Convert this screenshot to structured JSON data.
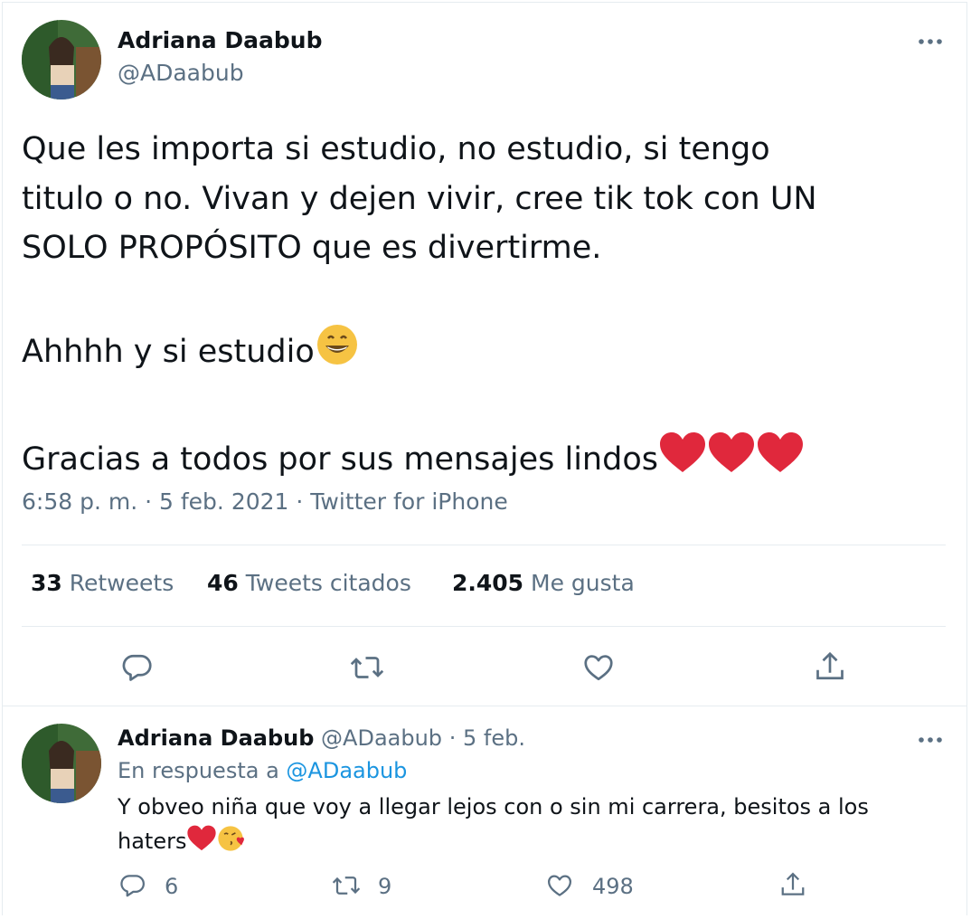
{
  "main_tweet": {
    "author_name": "Adriana Daabub",
    "author_handle": "@ADaabub",
    "text_line1": "Que les importa si estudio, no estudio, si tengo",
    "text_line2": "titulo o no. Vivan y dejen vivir, cree tik tok con UN",
    "text_line3": "SOLO PROPÓSITO que es divertirme.",
    "text_line4": "Ahhhh y si estudio",
    "text_line5": "Gracias a todos por sus mensajes lindos",
    "emoji_after_line4": "grinning-face-with-smiling-eyes",
    "emojis_after_line5": [
      "red-heart",
      "red-heart",
      "red-heart"
    ],
    "time": "6:58 p. m.",
    "date": "5 feb. 2021",
    "source": "Twitter for iPhone",
    "separator": "·",
    "stats": {
      "retweets_count": "33",
      "retweets_label": "Retweets",
      "quotes_count": "46",
      "quotes_label": "Tweets citados",
      "likes_count": "2.405",
      "likes_label": "Me gusta"
    }
  },
  "reply_tweet": {
    "author_name": "Adriana Daabub",
    "author_handle": "@ADaabub",
    "separator": "·",
    "date": "5 feb.",
    "in_reply_prefix": "En respuesta a",
    "in_reply_handle": "@ADaabub",
    "text_line1": "Y obveo niña que voy a llegar lejos con o sin mi carrera, besitos a los",
    "text_line2": "haters",
    "emojis_after_text": [
      "red-heart",
      "face-blowing-a-kiss"
    ],
    "reply_count": "6",
    "retweet_count": "9",
    "like_count": "498"
  },
  "icons": [
    "more-icon",
    "reply-icon",
    "retweet-icon",
    "like-icon",
    "share-icon"
  ],
  "colors": {
    "text": "#0f1419",
    "secondary": "#5b7083",
    "link": "#1b95e0",
    "divider": "#e6ecf0",
    "heart_emoji": "#e0283c",
    "smile_emoji": "#f6c343"
  }
}
